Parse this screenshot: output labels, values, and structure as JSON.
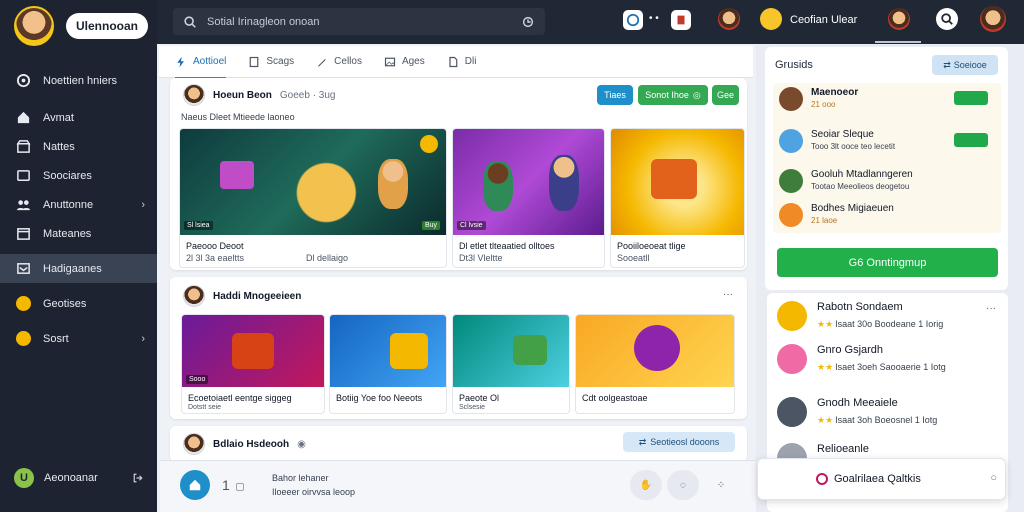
{
  "sidebar": {
    "profile_name": "Ulennooan",
    "items": [
      {
        "label": "Noettien hniers",
        "icon": "target-icon"
      },
      {
        "label": "Avmat",
        "icon": "home-icon"
      },
      {
        "label": "Nattes",
        "icon": "store-icon"
      },
      {
        "label": "Soociares",
        "icon": "chat-icon"
      },
      {
        "label": "Anuttonne",
        "icon": "people-icon",
        "chevron": true
      },
      {
        "label": "Mateanes",
        "icon": "calendar-icon"
      },
      {
        "label": "Hadigaanes",
        "icon": "inbox-icon",
        "active": true
      },
      {
        "label": "Geotises",
        "icon": "coin-icon"
      },
      {
        "label": "Sosrt",
        "icon": "coin-icon",
        "chevron": true
      }
    ],
    "footer_badge": "U",
    "footer_label": "Aeonoanar"
  },
  "topbar": {
    "search_placeholder": "Sotial Irinagleon onoan",
    "user_label": "Ceofian Ulear"
  },
  "tabs": [
    {
      "label": "Aottioel",
      "icon": "bolt-icon",
      "active": true
    },
    {
      "label": "Scags",
      "icon": "page-icon"
    },
    {
      "label": "Cellos",
      "icon": "pen-icon"
    },
    {
      "label": "Ages",
      "icon": "image-icon"
    },
    {
      "label": "Dli",
      "icon": "file-icon"
    }
  ],
  "post1": {
    "author": "Hoeun Beon",
    "meta": "Goeeb · 3ug",
    "btn_follow": "Tiaes",
    "btn_join": "Sonot Ihoe",
    "btn_more": "Gee",
    "caption": "Naeus Dleet Mtieede laoneo",
    "tiles": [
      {
        "title": "Paeooo Deoot",
        "sub": "2l 3l 3a  eaeltts",
        "extra": "Dl dellaigo",
        "tag": "Sl lsiea",
        "price": "Buy"
      },
      {
        "title": "Dl etlet tlteaatied olltoes",
        "sub": "Dt3l Vleltte",
        "tag": "Cl lvsie",
        "price": ""
      },
      {
        "title": "Pooiiloeoeat tlige",
        "sub": "Sooeatll",
        "tag": "",
        "price": ""
      }
    ]
  },
  "post2": {
    "author": "Haddi Mnogeeieen",
    "more": "···",
    "tiles": [
      {
        "title": "Ecoetoiaetl eentge siggeg",
        "sub": "Dotstt seie",
        "tag": "Sooo"
      },
      {
        "title": "Botiig Yoe foo Neeots",
        "sub": ""
      },
      {
        "title": "Paeote Ol",
        "sub": "Sclsesie"
      },
      {
        "title": "Cdt oolgeastoae",
        "sub": ""
      }
    ]
  },
  "post3": {
    "author": "Bdlaio Hsdeooh",
    "btn": "Seotieosl dooons"
  },
  "footer": {
    "count": "1",
    "line1": "Bahor lehaner",
    "line2": "Iloeeer oirvvsa leoop"
  },
  "groups": {
    "title": "Grusids",
    "join_label": "Soeiooe",
    "items": [
      {
        "name": "Maenoeor",
        "sub": "21 ooo",
        "color": "#7a4a2c"
      },
      {
        "name": "Seoiar Sleque",
        "sub": "Tooo 3lt ooce teo lecetit",
        "color": "#4fa3e0"
      },
      {
        "name": "Gooluh Mtadlanngeren",
        "sub": "Tootao Meeolieos deogetou",
        "color": "#3e7d3a"
      },
      {
        "name": "Bodhes Migiaeuen",
        "sub": "21 laoe",
        "color": "#f08a24"
      }
    ],
    "button": "G6 Onntingmup"
  },
  "recent": {
    "more": "···",
    "items": [
      {
        "name": "Rabotn Sondaem",
        "sub": "Isaat 30o Boodeane 1 Iorig",
        "color": "#f5b800",
        "more": "···"
      },
      {
        "name": "Gnro Gsjardh",
        "sub": "Isaet 3oeh Saooaerie 1 Iotg",
        "color": "#f06aa6"
      },
      {
        "name": "Gnodh Meeaiele",
        "sub": "Isaat 3oh Boeosnel 1 Iotg",
        "color": "#4b5563"
      },
      {
        "name": "Relioeanle",
        "sub": "",
        "color": "#9ca3af"
      }
    ]
  },
  "popup": {
    "label": "Goalrilaea Qaltkis"
  }
}
